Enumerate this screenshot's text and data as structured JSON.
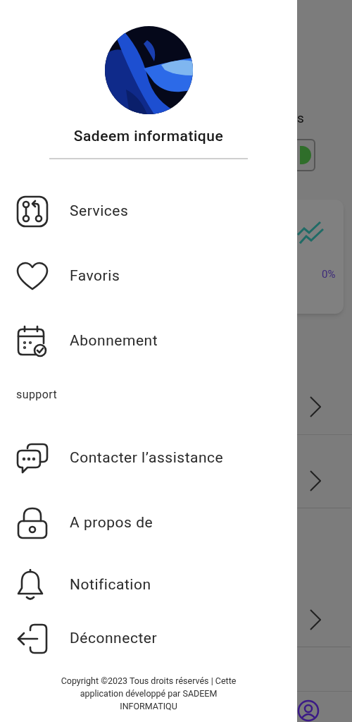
{
  "drawer": {
    "profile": {
      "name": "Sadeem informatique"
    },
    "menu": [
      {
        "label": "Services"
      },
      {
        "label": "Favoris"
      },
      {
        "label": "Abonnement"
      }
    ],
    "support_section": {
      "heading": "support",
      "items": [
        {
          "label": "Contacter l’assistance"
        },
        {
          "label": "A propos de"
        },
        {
          "label": "Notification"
        },
        {
          "label": "Déconnecter"
        }
      ]
    },
    "footer": "Copyright ©2023 Tous droits réservés | Cette application développé par SADEEM INFORMATIQU"
  },
  "background": {
    "heading_fragment": "s",
    "stat_value": "0%"
  }
}
